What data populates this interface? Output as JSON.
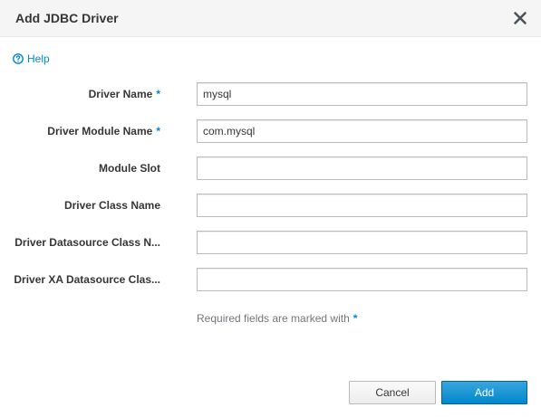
{
  "dialog": {
    "title": "Add JDBC Driver",
    "help_label": "Help"
  },
  "form": {
    "fields": [
      {
        "label": "Driver Name",
        "required": true,
        "value": "mysql"
      },
      {
        "label": "Driver Module Name",
        "required": true,
        "value": "com.mysql"
      },
      {
        "label": "Module Slot",
        "required": false,
        "value": ""
      },
      {
        "label": "Driver Class Name",
        "required": false,
        "value": ""
      },
      {
        "label": "Driver Datasource Class N...",
        "required": false,
        "value": ""
      },
      {
        "label": "Driver XA Datasource Clas...",
        "required": false,
        "value": ""
      }
    ],
    "required_marker": "*",
    "required_note": "Required fields are marked with"
  },
  "footer": {
    "cancel_label": "Cancel",
    "add_label": "Add"
  },
  "colors": {
    "accent": "#0088ce",
    "header_bg": "#f5f5f5",
    "primary_button": "#0088ce"
  },
  "icons": {
    "close": "close-icon",
    "help": "help-circle-icon"
  }
}
